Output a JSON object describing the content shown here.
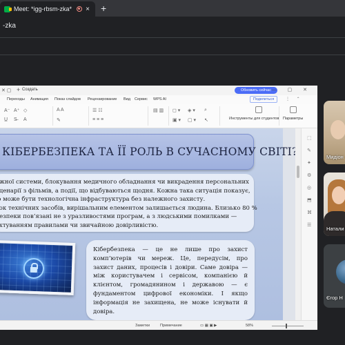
{
  "browser": {
    "tab_title": "Meet: *igg-rbsm-zka*",
    "tab_close": "×",
    "new_tab": "+",
    "address": "-zka"
  },
  "ppt": {
    "create_label": "Создать",
    "update_button": "Обновить сейчас",
    "share_button": "Поделиться",
    "menu": [
      "Переходы",
      "Анимация",
      "Показ слайдов",
      "Рецензирование",
      "Вид",
      "Сервис",
      "WPS AI"
    ],
    "ribbon_present_label": "Инструменты для студентов",
    "ribbon_params_label": "Параметры",
    "status_notes": "Заметки",
    "status_comment": "Примечание",
    "status_zoom": "58%"
  },
  "slide": {
    "title": "КІБЕРБЕЗПЕКА ТА ЇЇ РОЛЬ В СУЧАСНОМУ СВІТІ?",
    "body1_lines": [
      "ежної системи, блокування медичного обладнання чи викрадення персональних",
      "сценарії з фільмів, а події, що відбуваються щодня. Кожна така ситуація показує,",
      "ю може бути технологічна інфраструктура без належного захисту.",
      "ток технічних засобів, вирішальним елементом залишається людина. Близько 80 %",
      "безпеки пов’язані не з уразливостями програм, а з людськими помилками —",
      "ехтуванням правилами чи звичайною довірливістю."
    ],
    "body2": "Кібербезпека — це не лише про захист комп’ютерів чи мереж. Це, передусім, про захист даних, процесів і довіри. Саме довіра — між користувачем і сервісом, компанією й клієнтом, громадянином і державою — є фундаментом цифрової економіки. І якщо інформація не захищена, не може існувати й довіра."
  },
  "participants": [
    {
      "name": "Мидіон"
    },
    {
      "name": "Натали"
    },
    {
      "name": "Єгор Н"
    }
  ]
}
